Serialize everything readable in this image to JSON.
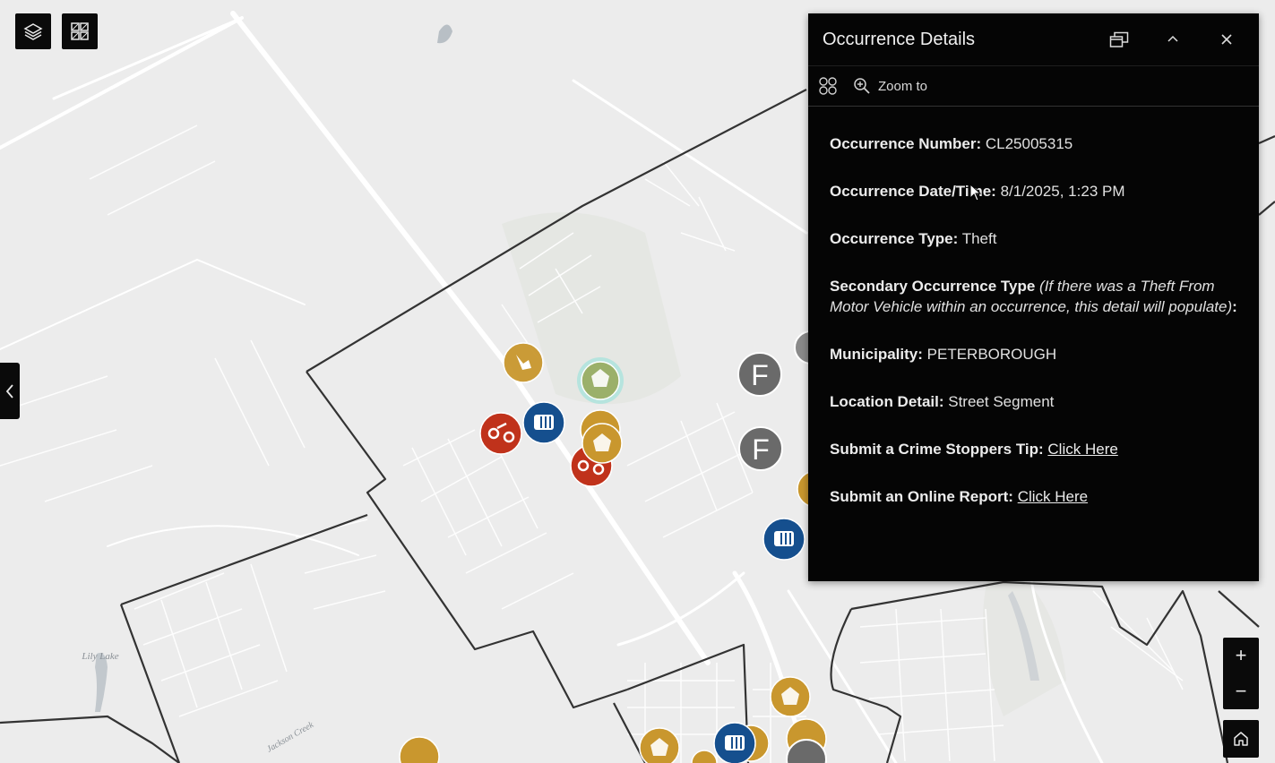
{
  "popup": {
    "title": "Occurrence Details",
    "zoom_to_label": "Zoom to",
    "fields": {
      "number_label": "Occurrence Number:",
      "number_value": "CL25005315",
      "datetime_label": "Occurrence Date/Time:",
      "datetime_value": "8/1/2025, 1:23 PM",
      "type_label": "Occurrence Type:",
      "type_value": "Theft",
      "secondary_label": "Secondary Occurrence Type",
      "secondary_note": "(If there was a Theft From Motor Vehicle within an occurrence, this detail will populate)",
      "secondary_colon": ":",
      "municipality_label": "Municipality:",
      "municipality_value": "PETERBOROUGH",
      "location_label": "Location Detail:",
      "location_value": "Street Segment",
      "crime_stoppers_label": "Submit a Crime Stoppers Tip:",
      "crime_stoppers_link": "Click Here",
      "online_report_label": "Submit an Online Report:",
      "online_report_link": "Click Here"
    }
  },
  "map": {
    "place_labels": [
      "Lily Lake",
      "Jackson Creek"
    ],
    "marker_letter": "F",
    "colors": {
      "theft": "#c9972e",
      "selected": "#9bb06a",
      "blue_marker": "#154f8e",
      "red_marker": "#c0321b",
      "grey_marker": "#6a6a6a",
      "boundary": "#333333",
      "road": "#ffffff",
      "background": "#ececec"
    }
  },
  "controls": {
    "zoom_in": "+",
    "zoom_out": "−"
  }
}
